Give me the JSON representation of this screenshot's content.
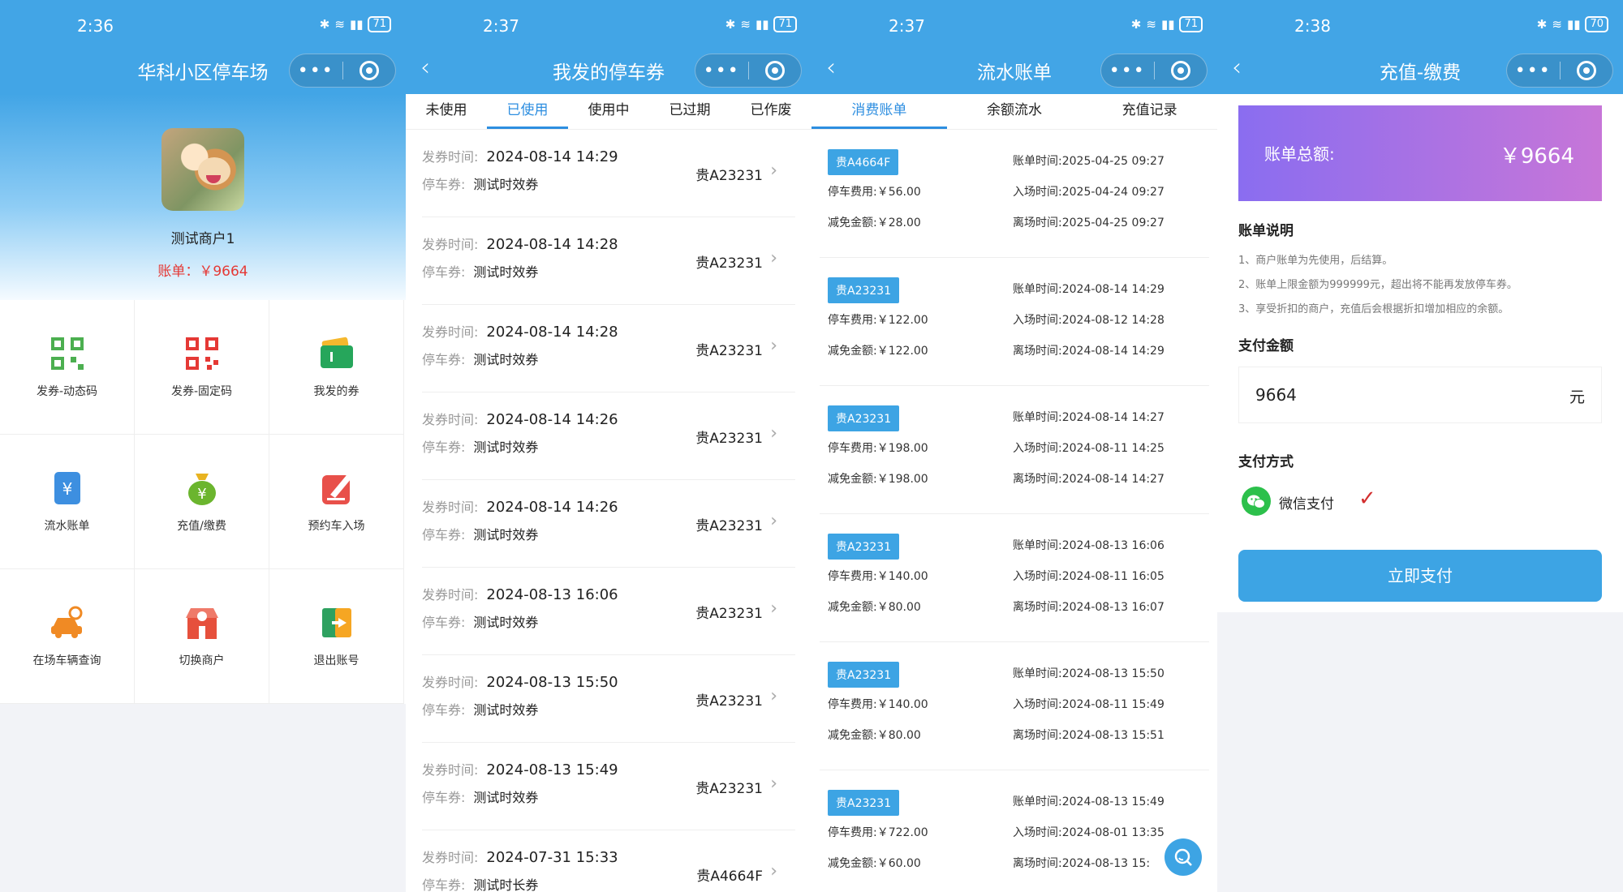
{
  "status_bar": [
    {
      "time": "2:36",
      "battery": "71"
    },
    {
      "time": "2:37",
      "battery": "71"
    },
    {
      "time": "2:37",
      "battery": "71"
    },
    {
      "time": "2:38",
      "battery": "70"
    }
  ],
  "capsule": {
    "more": "•••"
  },
  "home": {
    "title": "华科小区停车场",
    "merchant_name": "测试商户1",
    "bill_label": "账单：",
    "bill_value": "￥9664",
    "menu": [
      {
        "label": "发券-动态码",
        "icon": "qr-dynamic-icon",
        "color": "#4caf50"
      },
      {
        "label": "发券-固定码",
        "icon": "qr-fixed-icon",
        "color": "#e53935"
      },
      {
        "label": "我发的券",
        "icon": "ticket-icon",
        "color": "#26a65b"
      },
      {
        "label": "流水账单",
        "icon": "bill-icon",
        "color": "#3d8fe0"
      },
      {
        "label": "充值/缴费",
        "icon": "money-bag-icon",
        "color": "#6bb52e"
      },
      {
        "label": "预约车入场",
        "icon": "reserve-icon",
        "color": "#e8504a"
      },
      {
        "label": "在场车辆查询",
        "icon": "car-search-icon",
        "color": "#f08a24"
      },
      {
        "label": "切换商户",
        "icon": "shop-icon",
        "color": "#e6503c"
      },
      {
        "label": "退出账号",
        "icon": "logout-icon",
        "color": "#2ea160"
      }
    ]
  },
  "vouchers": {
    "title": "我发的停车券",
    "tabs": [
      "未使用",
      "已使用",
      "使用中",
      "已过期",
      "已作废"
    ],
    "active_tab": 1,
    "time_label": "发券时间:",
    "type_label": "停车券:",
    "items": [
      {
        "time": "2024-08-14 14:29",
        "type": "测试时效券",
        "plate": "贵A23231"
      },
      {
        "time": "2024-08-14 14:28",
        "type": "测试时效券",
        "plate": "贵A23231"
      },
      {
        "time": "2024-08-14 14:28",
        "type": "测试时效券",
        "plate": "贵A23231"
      },
      {
        "time": "2024-08-14 14:26",
        "type": "测试时效券",
        "plate": "贵A23231"
      },
      {
        "time": "2024-08-14 14:26",
        "type": "测试时效券",
        "plate": "贵A23231"
      },
      {
        "time": "2024-08-13 16:06",
        "type": "测试时效券",
        "plate": "贵A23231"
      },
      {
        "time": "2024-08-13 15:50",
        "type": "测试时效券",
        "plate": "贵A23231"
      },
      {
        "time": "2024-08-13 15:49",
        "type": "测试时效券",
        "plate": "贵A23231"
      },
      {
        "time": "2024-07-31 15:33",
        "type": "测试时长券",
        "plate": "贵A4664F"
      }
    ]
  },
  "ledger": {
    "title": "流水账单",
    "tabs": [
      "消费账单",
      "余额流水",
      "充值记录"
    ],
    "active_tab": 0,
    "labels": {
      "fee": "停车费用:",
      "discount": "减免金额:",
      "bill_time": "账单时间:",
      "in_time": "入场时间:",
      "out_time": "离场时间:"
    },
    "items": [
      {
        "plate": "贵A4664F",
        "fee": "￥56.00",
        "discount": "￥28.00",
        "bill_time": "2025-04-25 09:27",
        "in_time": "2025-04-24 09:27",
        "out_time": "2025-04-25 09:27"
      },
      {
        "plate": "贵A23231",
        "fee": "￥122.00",
        "discount": "￥122.00",
        "bill_time": "2024-08-14 14:29",
        "in_time": "2024-08-12 14:28",
        "out_time": "2024-08-14 14:29"
      },
      {
        "plate": "贵A23231",
        "fee": "￥198.00",
        "discount": "￥198.00",
        "bill_time": "2024-08-14 14:27",
        "in_time": "2024-08-11 14:25",
        "out_time": "2024-08-14 14:27"
      },
      {
        "plate": "贵A23231",
        "fee": "￥140.00",
        "discount": "￥80.00",
        "bill_time": "2024-08-13 16:06",
        "in_time": "2024-08-11 16:05",
        "out_time": "2024-08-13 16:07"
      },
      {
        "plate": "贵A23231",
        "fee": "￥140.00",
        "discount": "￥80.00",
        "bill_time": "2024-08-13 15:50",
        "in_time": "2024-08-11 15:49",
        "out_time": "2024-08-13 15:51"
      },
      {
        "plate": "贵A23231",
        "fee": "￥722.00",
        "discount": "￥60.00",
        "bill_time": "2024-08-13 15:49",
        "in_time": "2024-08-01 13:35",
        "out_time": "2024-08-13 15:"
      }
    ]
  },
  "recharge": {
    "title": "充值-缴费",
    "total_label": "账单总额:",
    "total_value": "￥9664",
    "desc_title": "账单说明",
    "desc_lines": [
      "1、商户账单为先使用，后结算。",
      "2、账单上限金额为999999元，超出将不能再发放停车券。",
      "3、享受折扣的商户，充值后会根据折扣增加相应的余额。"
    ],
    "amount_title": "支付金额",
    "amount_value": "9664",
    "amount_unit": "元",
    "method_title": "支付方式",
    "method_label": "微信支付",
    "pay_button": "立即支付"
  }
}
